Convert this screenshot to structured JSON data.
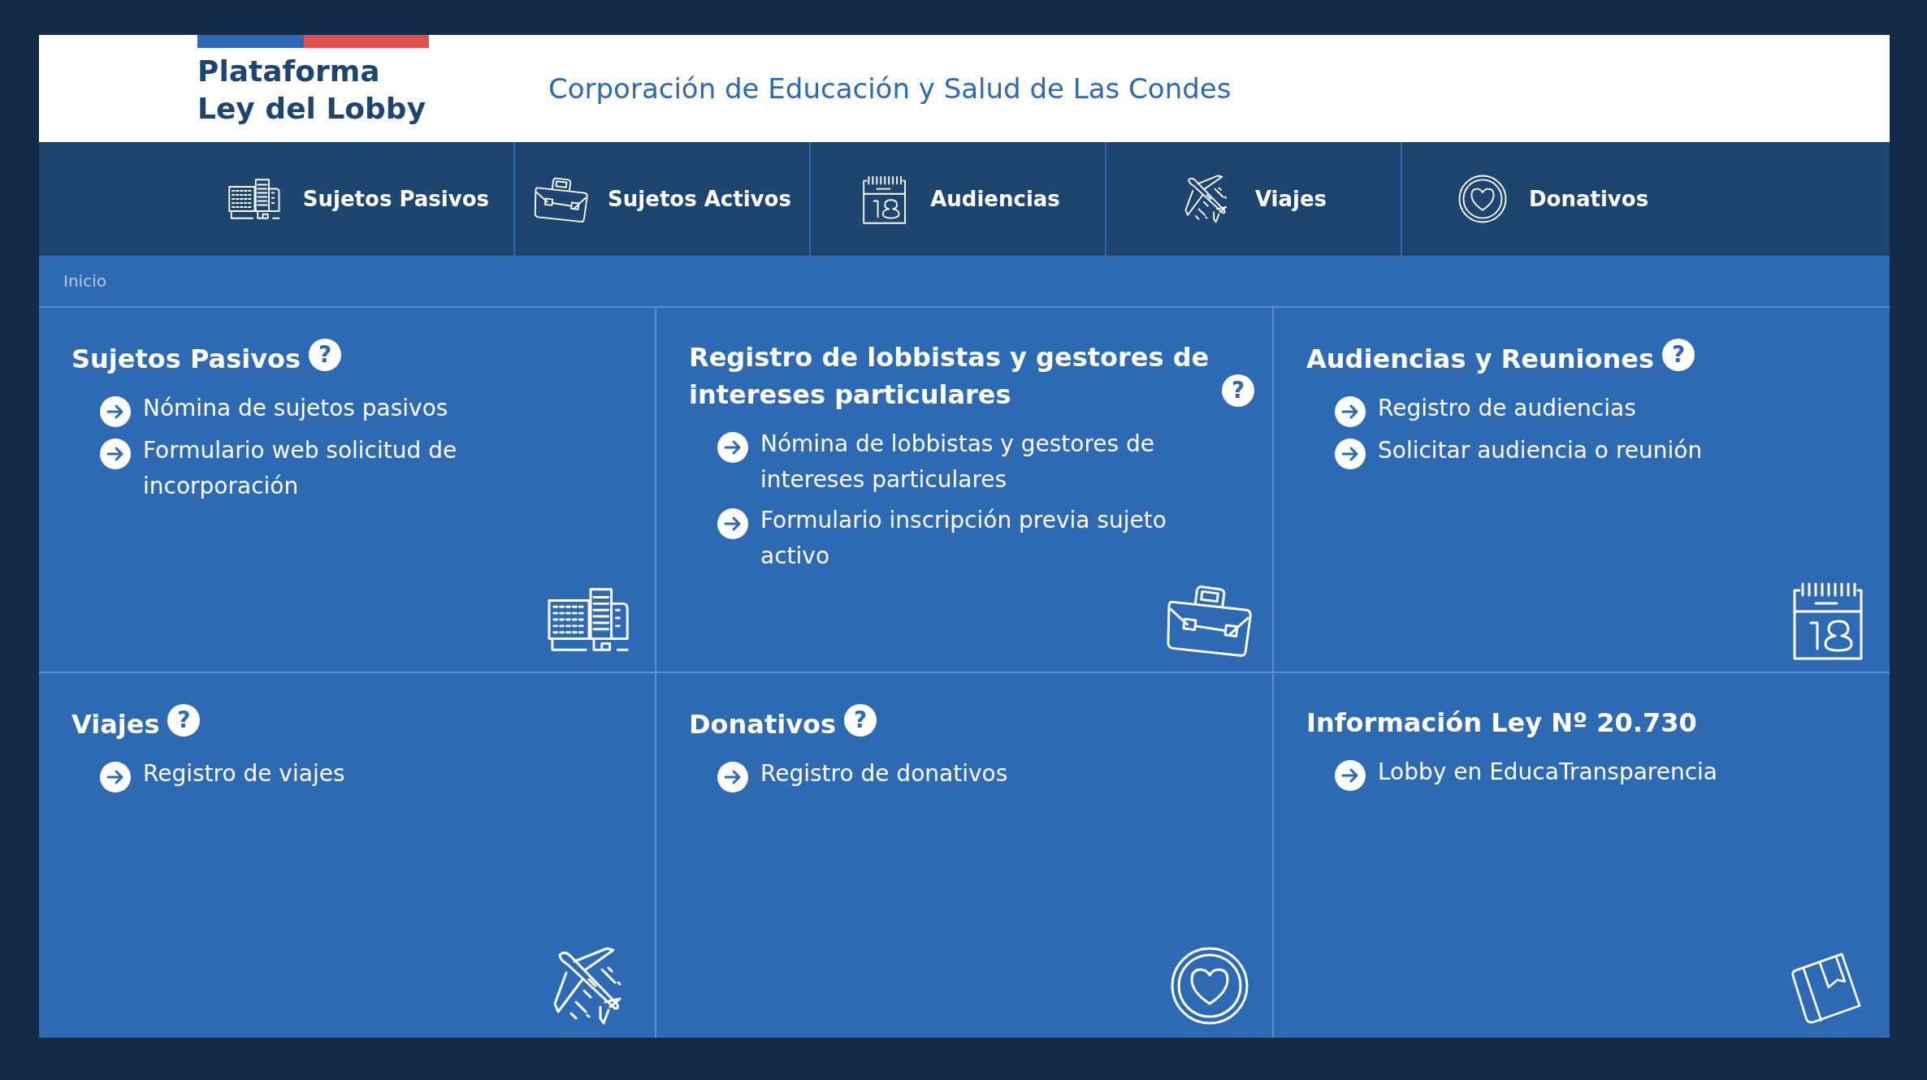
{
  "header": {
    "title_lines": [
      "Plataforma",
      "Ley del Lobby"
    ],
    "organization": "Corporación de Educación y Salud de Las Condes"
  },
  "nav": [
    {
      "label": "Sujetos Pasivos",
      "kind": "building"
    },
    {
      "label": "Sujetos Activos",
      "kind": "briefcase"
    },
    {
      "label": "Audiencias",
      "kind": "calendar"
    },
    {
      "label": "Viajes",
      "kind": "plane"
    },
    {
      "label": "Donativos",
      "kind": "heart"
    }
  ],
  "breadcrumb": [
    "Inicio"
  ],
  "cards": [
    {
      "title": "Sujetos Pasivos",
      "help": "?",
      "kind": "building",
      "links": [
        "Nómina de sujetos pasivos",
        "Formulario web solicitud de incorporación"
      ]
    },
    {
      "title": "Registro de lobbistas y gestores de intereses particulares",
      "help": "?",
      "kind": "briefcase",
      "links": [
        "Nómina de lobbistas y gestores de intereses particulares",
        "Formulario inscripción previa sujeto activo"
      ]
    },
    {
      "title": "Audiencias y Reuniones",
      "help": "?",
      "kind": "calendar",
      "links": [
        "Registro de audiencias",
        "Solicitar audiencia o reunión"
      ]
    },
    {
      "title": "Viajes",
      "help": "?",
      "kind": "plane",
      "links": [
        "Registro de viajes"
      ]
    },
    {
      "title": "Donativos",
      "help": "?",
      "kind": "heart",
      "links": [
        "Registro de donativos"
      ]
    },
    {
      "title": "Información Ley Nº 20.730",
      "kind": "book",
      "links": [
        "Lobby en EducaTransparencia"
      ]
    }
  ]
}
